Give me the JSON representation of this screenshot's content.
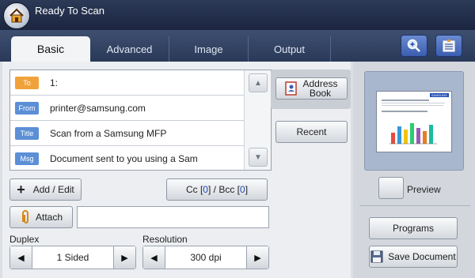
{
  "window": {
    "title": "Ready To Scan"
  },
  "tabs": [
    {
      "label": "Basic",
      "active": true
    },
    {
      "label": "Advanced",
      "active": false
    },
    {
      "label": "Image",
      "active": false
    },
    {
      "label": "Output",
      "active": false
    }
  ],
  "toolbar": {
    "zoom_icon": "zoom-in-icon",
    "list_icon": "job-list-icon"
  },
  "fields": [
    {
      "tag": "To",
      "tag_color": "#f0a23a",
      "value": "1:"
    },
    {
      "tag": "From",
      "tag_color": "#5b8fd6",
      "value": "printer@samsung.com"
    },
    {
      "tag": "Title",
      "tag_color": "#5b8fd6",
      "value": "Scan from a Samsung MFP"
    },
    {
      "tag": "Msg",
      "tag_color": "#5b8fd6",
      "value": "Document sent to you using a Sam"
    }
  ],
  "buttons": {
    "address_book": "Address Book",
    "recent": "Recent",
    "add_edit": "Add / Edit",
    "cc_prefix": "Cc [",
    "cc_count": "0",
    "bcc_prefix": "] / Bcc [",
    "bcc_count": "0",
    "bcc_suffix": "]",
    "attach": "Attach",
    "preview": "Preview",
    "programs": "Programs",
    "save_document": "Save Document"
  },
  "attach_value": "",
  "duplex": {
    "label": "Duplex",
    "value": "1 Sided"
  },
  "resolution": {
    "label": "Resolution",
    "value": "300 dpi"
  },
  "preview_page_header": "SAMSUNG"
}
